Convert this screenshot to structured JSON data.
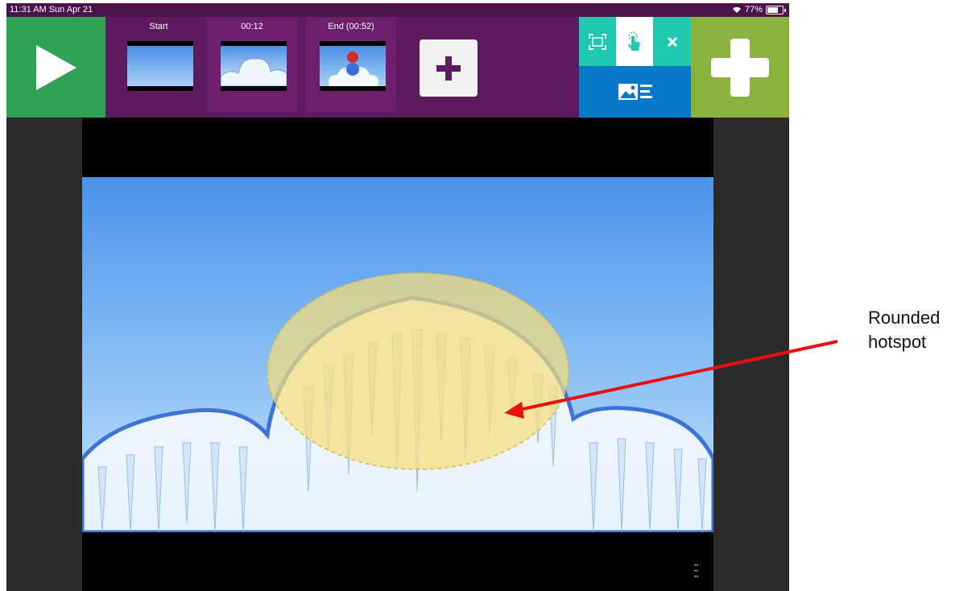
{
  "status_bar": {
    "time": "11:31 AM  Sun Apr 21",
    "battery": "77%"
  },
  "toolbar": {
    "play_icon": "play-icon",
    "clips": [
      {
        "label": "Start"
      },
      {
        "label": "00:12"
      },
      {
        "label": "End (00:52)"
      }
    ],
    "add_clip_icon": "plus-icon",
    "tools": {
      "fit_icon": "fit-screen-icon",
      "hotspot_icon": "touch-hotspot-icon",
      "close_icon": "close-icon",
      "media_icon": "image-text-icon"
    },
    "add_icon": "plus-icon"
  },
  "annotation": {
    "line1": "Rounded",
    "line2": "hotspot"
  },
  "colors": {
    "toolbar": "#5e1a5e",
    "play": "#2ea356",
    "tool_teal": "#1ec9b0",
    "tool_blue": "#0a78c8",
    "add_green": "#8ab23d",
    "hotspot": "#f5de7a",
    "arrow": "#e81010"
  }
}
